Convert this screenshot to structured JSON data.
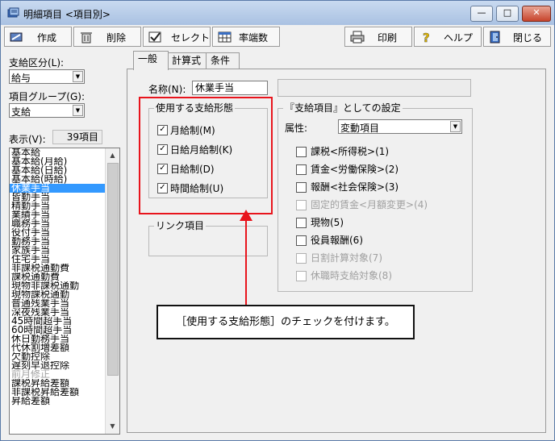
{
  "window": {
    "title": "明細項目 <項目別>"
  },
  "window_buttons": {
    "minimize": "—",
    "maximize": "□",
    "close": "✕"
  },
  "toolbar": {
    "create": "作成",
    "delete": "削除",
    "select": "セレクト",
    "rounding": "率端数",
    "print": "印刷",
    "help": "ヘルプ",
    "close": "閉じる"
  },
  "left": {
    "pay_type_label": "支給区分(L):",
    "pay_type_value": "給与",
    "group_label": "項目グループ(G):",
    "group_value": "支給",
    "display_label": "表示(V):",
    "count": "39項目",
    "items": [
      "基本給",
      "基本給(月給)",
      "基本給(日給)",
      "基本給(時給)",
      "休業手当",
      "皆勤手当",
      "精勤手当",
      "業績手当",
      "職務手当",
      "役付手当",
      "勤務手当",
      "家族手当",
      "住宅手当",
      "非課税通勤費",
      "課税通勤費",
      "現物非課税通勤",
      "現物課税通勤",
      "普通残業手当",
      "深夜残業手当",
      "45時間超手当",
      "60時間超手当",
      "休日勤務手当",
      "代休割増差額",
      "欠勤控除",
      "遅刻早退控除",
      "前月修正",
      "課税昇給差額",
      "非課税昇給差額",
      "昇給差額"
    ],
    "selected_index": 4,
    "dim_index": 25
  },
  "tabs": [
    "一般",
    "計算式",
    "条件"
  ],
  "general": {
    "name_label": "名称(N):",
    "name_value": "休業手当",
    "usage_group_title": "使用する支給形態",
    "usage_options": [
      {
        "label": "月給制(M)",
        "checked": true
      },
      {
        "label": "日給月給制(K)",
        "checked": true
      },
      {
        "label": "日給制(D)",
        "checked": true
      },
      {
        "label": "時間給制(U)",
        "checked": true
      }
    ],
    "link_group_title": "リンク項目",
    "setting_group_title": "『支給項目』としての設定",
    "attribute_label": "属性:",
    "attribute_value": "変動項目",
    "setting_options": [
      {
        "label": "課税<所得税>(1)",
        "checked": false,
        "disabled": false
      },
      {
        "label": "賃金<労働保険>(2)",
        "checked": false,
        "disabled": false
      },
      {
        "label": "報酬<社会保険>(3)",
        "checked": false,
        "disabled": false
      },
      {
        "label": "固定的賃金<月額変更>(4)",
        "checked": false,
        "disabled": true
      },
      {
        "label": "現物(5)",
        "checked": false,
        "disabled": false
      },
      {
        "label": "役員報酬(6)",
        "checked": false,
        "disabled": false
      },
      {
        "label": "日割計算対象(7)",
        "checked": false,
        "disabled": true
      },
      {
        "label": "休職時支給対象(8)",
        "checked": false,
        "disabled": true
      }
    ]
  },
  "annotation": {
    "callout": "［使用する支給形態］のチェックを付けます。",
    "highlight_color": "#e8141c"
  }
}
